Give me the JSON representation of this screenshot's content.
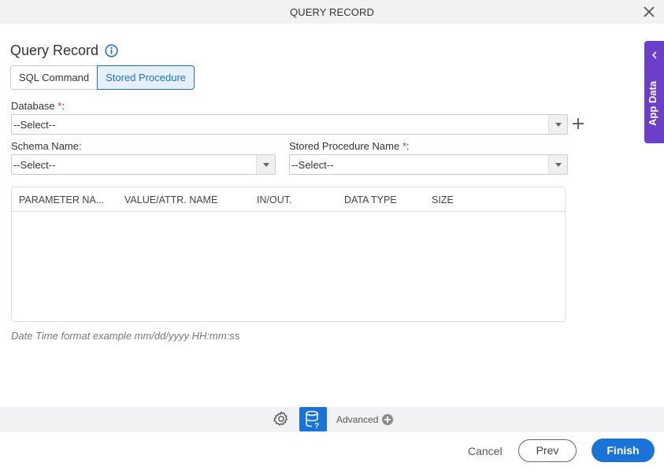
{
  "window": {
    "title": "QUERY RECORD"
  },
  "heading": {
    "title": "Query Record"
  },
  "tabs": [
    {
      "label": "SQL Command",
      "active": false
    },
    {
      "label": "Stored Procedure",
      "active": true
    }
  ],
  "form": {
    "database": {
      "label": "Database",
      "required_mark": "*",
      "suffix": ":",
      "value": "--Select--"
    },
    "schema": {
      "label": "Schema Name:",
      "value": "--Select--"
    },
    "procedure": {
      "label": "Stored Procedure Name",
      "required_mark": "*",
      "suffix": ":",
      "value": "--Select--"
    }
  },
  "grid": {
    "columns": [
      "PARAMETER NA...",
      "VALUE/ATTR. NAME",
      "IN/OUT.",
      "DATA TYPE",
      "SIZE"
    ],
    "rows": []
  },
  "hint": "Date Time format example mm/dd/yyyy HH:mm:ss",
  "toolbar": {
    "advanced_label": "Advanced"
  },
  "footer": {
    "cancel": "Cancel",
    "prev": "Prev",
    "finish": "Finish"
  },
  "side_panel": {
    "label": "App Data"
  },
  "colors": {
    "accent": "#1a73d9",
    "side_panel": "#6a3fc9",
    "required": "#c0392b"
  }
}
